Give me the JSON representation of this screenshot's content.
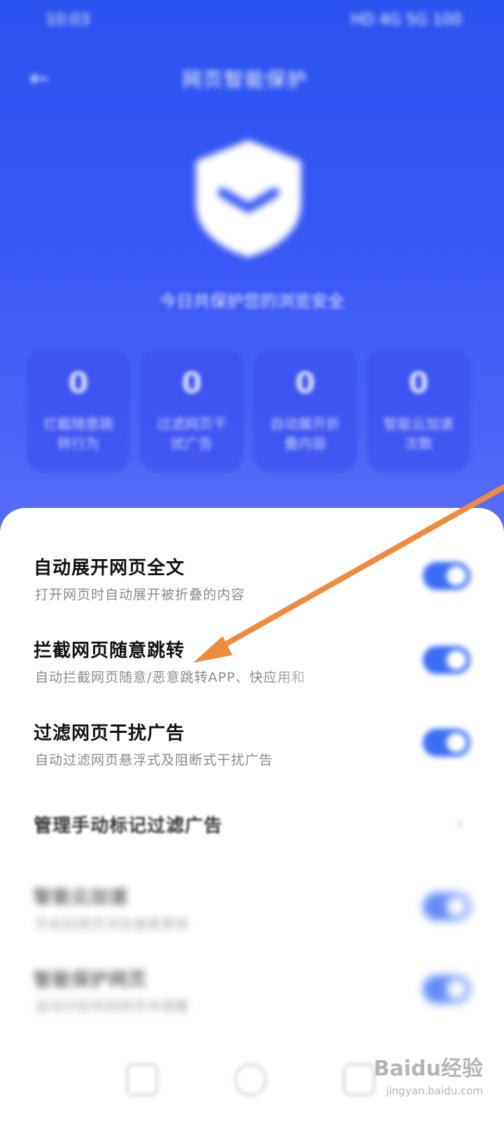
{
  "status_bar": {
    "time": "10:03",
    "indicators": "HD 4G 5G 100"
  },
  "header": {
    "back_icon": "back-arrow-icon",
    "title": "网页智能保护"
  },
  "hero": {
    "shield_icon": "shield-check-icon",
    "summary": "今日共保护您的浏览安全"
  },
  "stats": [
    {
      "value": "0",
      "label": "拦截随意跳转行为"
    },
    {
      "value": "0",
      "label": "过滤网页干扰广告"
    },
    {
      "value": "0",
      "label": "自动展开折叠内容"
    },
    {
      "value": "0",
      "label": "智能云加速次数"
    }
  ],
  "settings": [
    {
      "title": "自动展开网页全文",
      "subtitle": "打开网页时自动展开被折叠的内容",
      "enabled": true
    },
    {
      "title": "拦截网页随意跳转",
      "subtitle": "自动拦截网页随意/恶意跳转APP、快应用和",
      "enabled": true
    },
    {
      "title": "过滤网页干扰广告",
      "subtitle": "自动过滤网页悬浮式及阻断式干扰广告",
      "enabled": true
    },
    {
      "title": "管理手动标记过滤广告",
      "subtitle": "",
      "chevron": "chevron-right-icon"
    },
    {
      "title": "智能云加速",
      "subtitle": "开启后网页浏览速度更快",
      "enabled": true
    },
    {
      "title": "智能保护网页",
      "subtitle": "自动识别风险网页并提醒",
      "enabled": true
    }
  ],
  "annotation": {
    "color": "#f08a3c"
  },
  "watermark": {
    "brand": "Baidu经验",
    "url": "jingyan.baidu.com"
  },
  "colors": {
    "primary": "#2a52ee",
    "toggle_on": "#3b6ef6"
  }
}
